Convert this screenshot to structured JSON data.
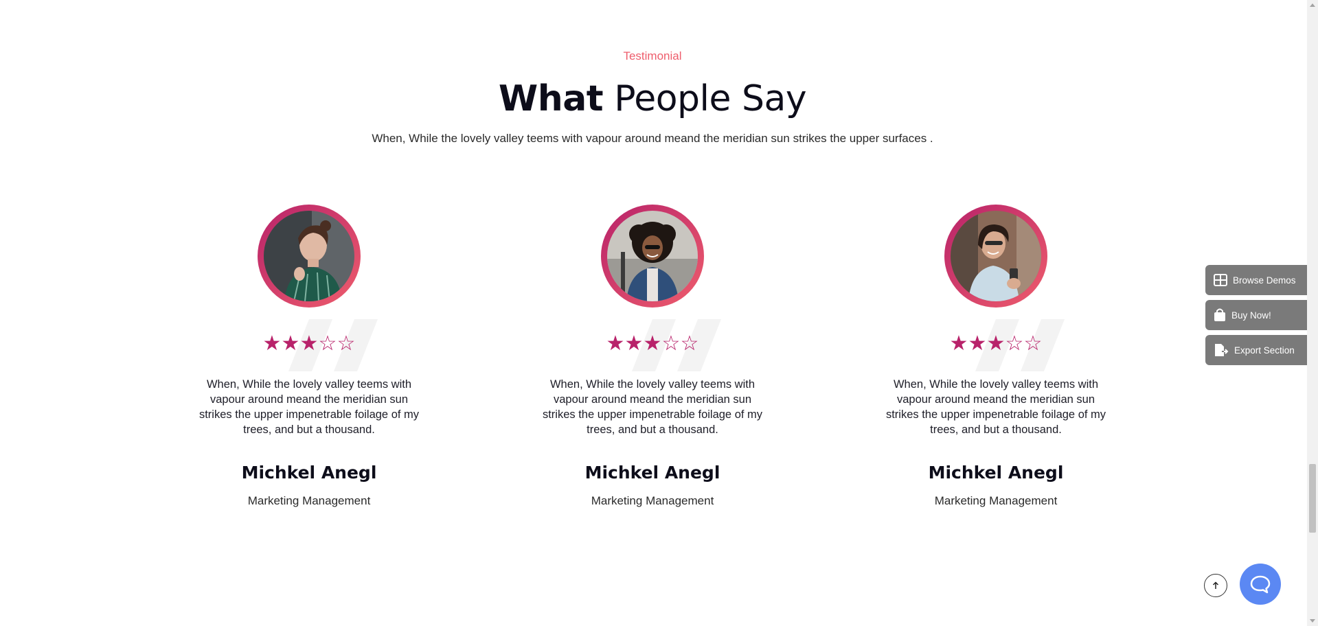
{
  "section": {
    "eyebrow": "Testimonial",
    "heading_strong": "What",
    "heading_light": "People Say",
    "subtitle": "When, While the lovely valley teems with vapour around meand the meridian sun strikes the upper surfaces ."
  },
  "testimonials": [
    {
      "rating": 3,
      "rating_max": 5,
      "quote": "When, While the lovely valley teems with vapour around meand the meridian sun strikes the upper impenetrable foilage of my trees, and but a thousand.",
      "name": "Michkel Anegl",
      "role": "Marketing Management"
    },
    {
      "rating": 3,
      "rating_max": 5,
      "quote": "When, While the lovely valley teems with vapour around meand the meridian sun strikes the upper impenetrable foilage of my trees, and but a thousand.",
      "name": "Michkel Anegl",
      "role": "Marketing Management"
    },
    {
      "rating": 3,
      "rating_max": 5,
      "quote": "When, While the lovely valley teems with vapour around meand the meridian sun strikes the upper impenetrable foilage of my trees, and but a thousand.",
      "name": "Michkel Anegl",
      "role": "Marketing Management"
    }
  ],
  "side_panel": {
    "browse_demos": "Browse Demos",
    "buy_now": "Buy Now!",
    "export_section": "Export Section"
  },
  "colors": {
    "accent": "#b8226a",
    "accent_light": "#ee5d6c",
    "chat": "#5b88f3",
    "side_button": "#7a7a7a"
  },
  "icons": {
    "browse_demos": "grid-icon",
    "buy_now": "shopping-bag-icon",
    "export_section": "export-file-icon",
    "back_to_top": "arrow-up-icon",
    "chat": "chat-bubble-icon"
  }
}
